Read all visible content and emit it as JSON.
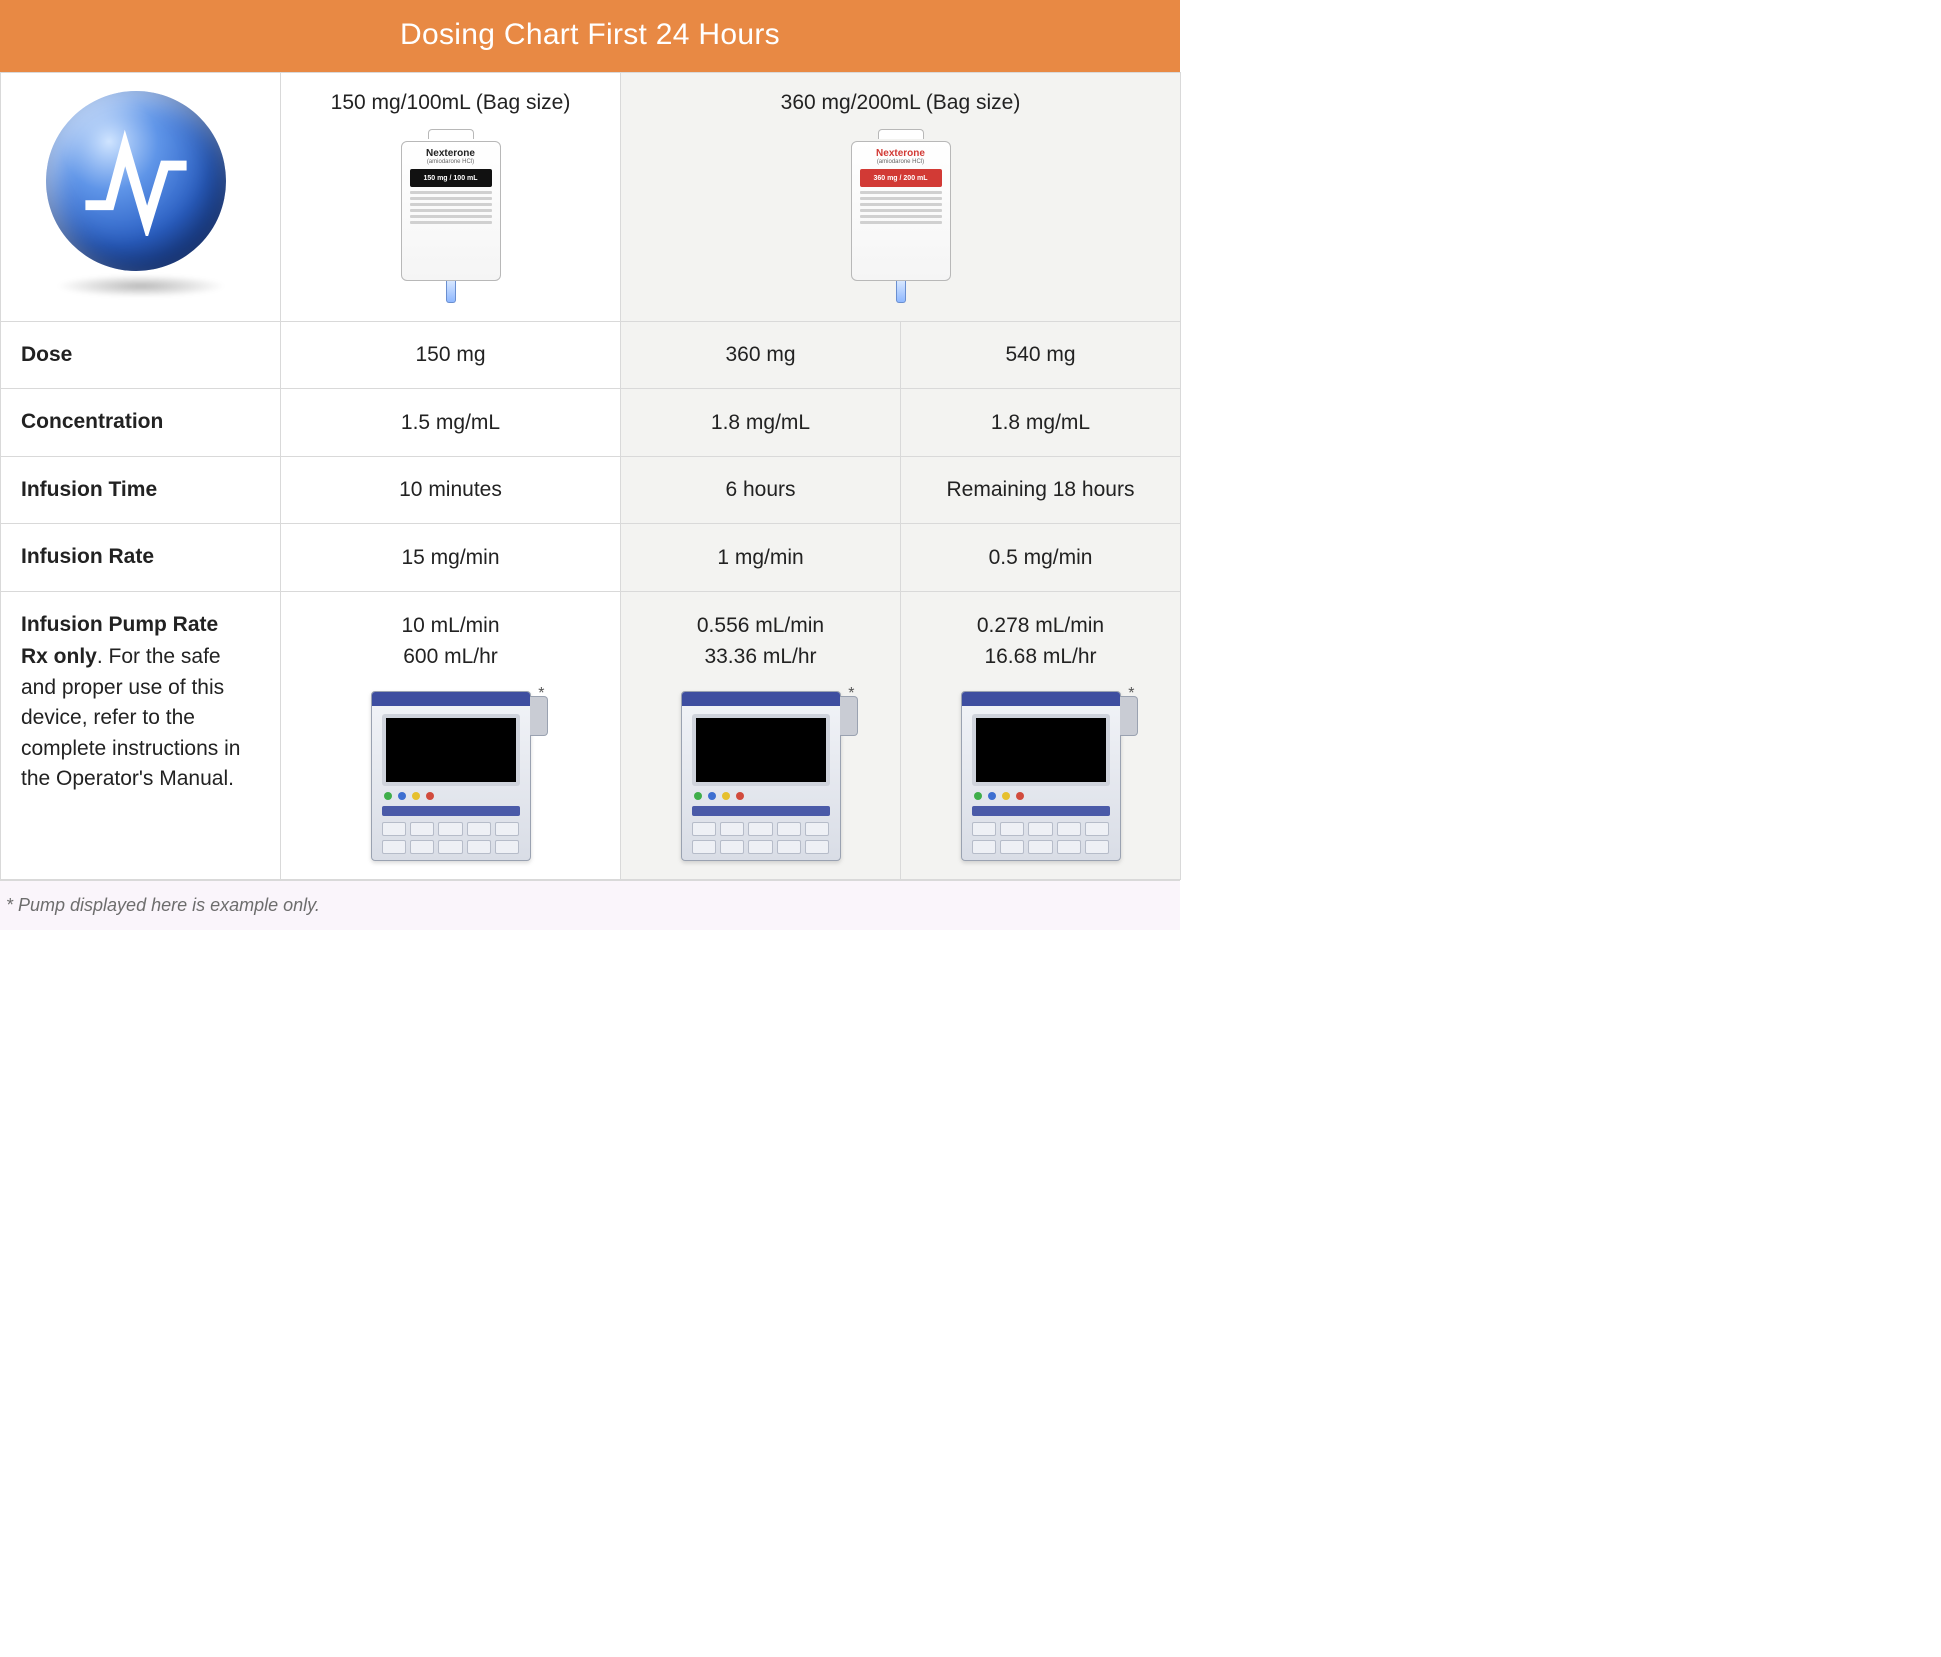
{
  "title": "Dosing Chart First 24 Hours",
  "logo_alt": "Nexterone logo",
  "bags": {
    "bag150": {
      "header": "150 mg/100mL (Bag size)",
      "brand": "Nexterone",
      "sub": "(amiodarone HCl)",
      "strip": "150 mg / 100 mL"
    },
    "bag360": {
      "header": "360 mg/200mL (Bag size)",
      "brand": "Nexterone",
      "sub": "(amiodarone HCl)",
      "strip": "360 mg / 200 mL"
    }
  },
  "rows": {
    "dose": {
      "label": "Dose",
      "c1": "150 mg",
      "c2": "360 mg",
      "c3": "540 mg"
    },
    "concentration": {
      "label": "Concentration",
      "c1": "1.5 mg/mL",
      "c2": "1.8 mg/mL",
      "c3": "1.8 mg/mL"
    },
    "inf_time": {
      "label": "Infusion Time",
      "c1": "10 minutes",
      "c2": "6 hours",
      "c3": "Remaining 18 hours"
    },
    "inf_rate": {
      "label": "Infusion Rate",
      "c1": "15 mg/min",
      "c2": "1 mg/min",
      "c3": "0.5 mg/min"
    }
  },
  "pump_row": {
    "title": "Infusion Pump Rate",
    "rx_strong": "Rx only",
    "rx_note": ". For the safe and proper use of this device, refer to the complete instructions in the Operator's Manual.",
    "c1": {
      "l1": "10 mL/min",
      "l2": "600 mL/hr"
    },
    "c2": {
      "l1": "0.556 mL/min",
      "l2": "33.36 mL/hr"
    },
    "c3": {
      "l1": "0.278 mL/min",
      "l2": "16.68 mL/hr"
    },
    "star": "*"
  },
  "footnote": "* Pump displayed here is example only.",
  "chart_data": {
    "type": "table",
    "title": "Dosing Chart First 24 Hours",
    "columns": [
      "150 mg/100mL (Bag size)",
      "360 mg/200mL (Bag size) — 6 hours",
      "360 mg/200mL (Bag size) — Remaining 18 hours"
    ],
    "rows": [
      {
        "label": "Dose",
        "values": [
          "150 mg",
          "360 mg",
          "540 mg"
        ]
      },
      {
        "label": "Concentration",
        "values": [
          "1.5 mg/mL",
          "1.8 mg/mL",
          "1.8 mg/mL"
        ]
      },
      {
        "label": "Infusion Time",
        "values": [
          "10 minutes",
          "6 hours",
          "Remaining 18 hours"
        ]
      },
      {
        "label": "Infusion Rate",
        "values": [
          "15 mg/min",
          "1 mg/min",
          "0.5 mg/min"
        ]
      },
      {
        "label": "Infusion Pump Rate",
        "values": [
          "10 mL/min; 600 mL/hr",
          "0.556 mL/min; 33.36 mL/hr",
          "0.278 mL/min; 16.68 mL/hr"
        ]
      }
    ]
  }
}
